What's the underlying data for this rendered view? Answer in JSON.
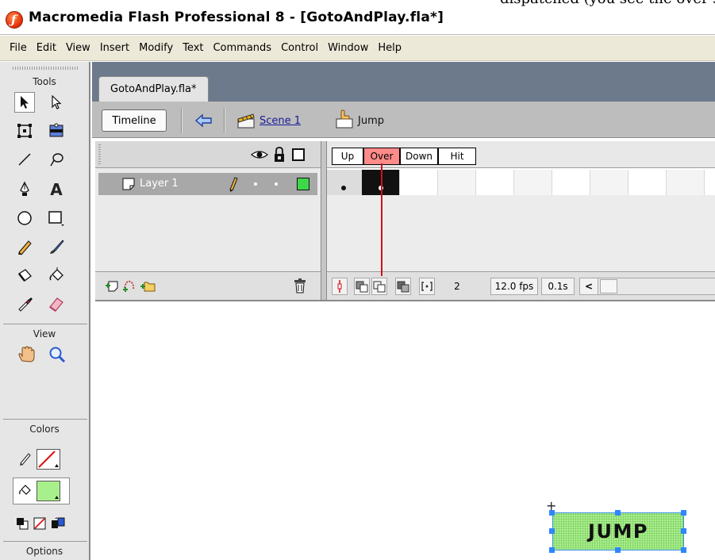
{
  "window": {
    "title": "Macromedia Flash Professional 8 - [GotoAndPlay.fla*]",
    "top_edge_text": "dispatched (you see the over state of the button with the mouse over it).",
    "icon": "flash-app-icon"
  },
  "menubar": {
    "items": [
      "File",
      "Edit",
      "View",
      "Insert",
      "Modify",
      "Text",
      "Commands",
      "Control",
      "Window",
      "Help"
    ]
  },
  "tools": {
    "header": "Tools",
    "view_header": "View",
    "colors_header": "Colors",
    "options_header": "Options",
    "items": [
      "arrow-icon",
      "subselect-icon",
      "free-transform-icon",
      "gradient-transform-icon",
      "line-icon",
      "lasso-icon",
      "pen-icon",
      "text-icon",
      "oval-icon",
      "rectangle-icon",
      "pencil-icon",
      "brush-icon",
      "ink-bottle-icon",
      "paint-bucket-icon",
      "eyedropper-icon",
      "eraser-icon",
      "hand-icon",
      "zoom-icon"
    ],
    "text_tool_label": "A",
    "fill_color": "#a8f08c",
    "stroke_color": "none"
  },
  "document": {
    "tab": "GotoAndPlay.fla*",
    "timeline_button": "Timeline",
    "scene": "Scene 1",
    "symbol": "Jump"
  },
  "timeline": {
    "layer_name": "Layer 1",
    "frame_labels": [
      "Up",
      "Over",
      "Down",
      "Hit"
    ],
    "active_frame_label": "Over",
    "current_frame": "2",
    "frame_rate": "12.0 fps",
    "elapsed_time": "0.1s",
    "scroll_left_glyph": "<"
  },
  "stage": {
    "button_text": "JUMP",
    "button_fill": "#a8f08c"
  }
}
